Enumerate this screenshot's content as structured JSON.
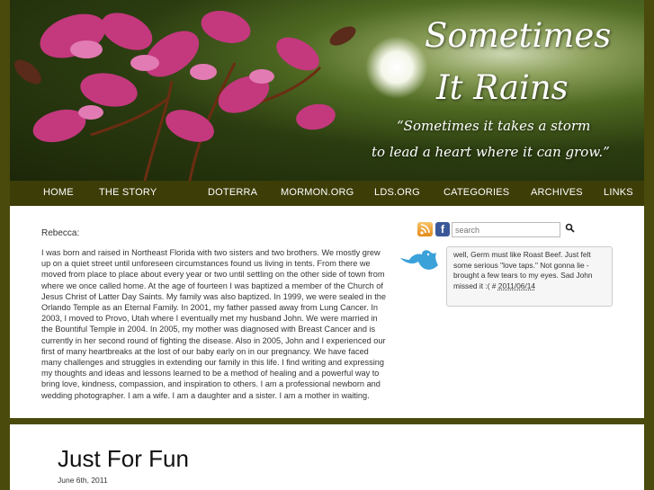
{
  "header": {
    "title_line1": "Sometimes",
    "title_line2": "It Rains",
    "quote_line1": "“Sometimes it takes a storm",
    "quote_line2": "to lead a heart where it can grow.”"
  },
  "nav": {
    "items": [
      {
        "label": "HOME"
      },
      {
        "label": "THE STORY"
      },
      {
        "label": "DOTERRA"
      },
      {
        "label": "MORMON.ORG"
      },
      {
        "label": "LDS.ORG"
      },
      {
        "label": "CATEGORIES"
      },
      {
        "label": "ARCHIVES"
      },
      {
        "label": "LINKS"
      }
    ]
  },
  "about": {
    "name": "Rebecca:",
    "text": "I was born and raised in Northeast Florida with two sisters and two brothers. We mostly grew up on a quiet street until unforeseen circumstances found us living in tents. From there we moved from place to place about every year or two until settling on the other side of town from where we once called home. At the age of fourteen I was baptized a member of the Church of Jesus Christ of Latter Day Saints. My family was also baptized. In 1999, we were sealed in the Orlando Temple as an Eternal Family. In 2001, my father passed away from Lung Cancer. In 2003, I moved to Provo, Utah where I eventually met my husband John. We were married in the Bountiful Temple in 2004. In 2005, my mother was diagnosed with Breast Cancer and is currently in her second round of fighting the disease. Also in 2005, John and I experienced our first of many heartbreaks at the lost of our baby early on in our pregnancy. We have faced many challenges and struggles in extending our family in this life. I find writing and expressing my thoughts and ideas and lessons learned to be a method of healing and a powerful way to bring love, kindness, compassion, and inspiration to others. I am a professional newborn and wedding photographer. I am a wife. I am a daughter and a sister. I am a mother in waiting."
  },
  "sidebar": {
    "rss_icon": "rss-icon",
    "facebook_icon": "facebook-icon",
    "facebook_glyph": "f",
    "search_placeholder": "search",
    "search_button": "🔍",
    "tweet_text": "well, Germ must like Roast Beef. Just felt some serious \"love taps.\" Not gonna lie - brought a few tears to my eyes. Sad John missed it :( # ",
    "tweet_date": "2011/06/14"
  },
  "post": {
    "title": "Just For Fun",
    "date": "June 6th, 2011"
  },
  "colors": {
    "frame": "#4a4a0c",
    "nav": "#3d3d08",
    "facebook": "#3b5998"
  }
}
